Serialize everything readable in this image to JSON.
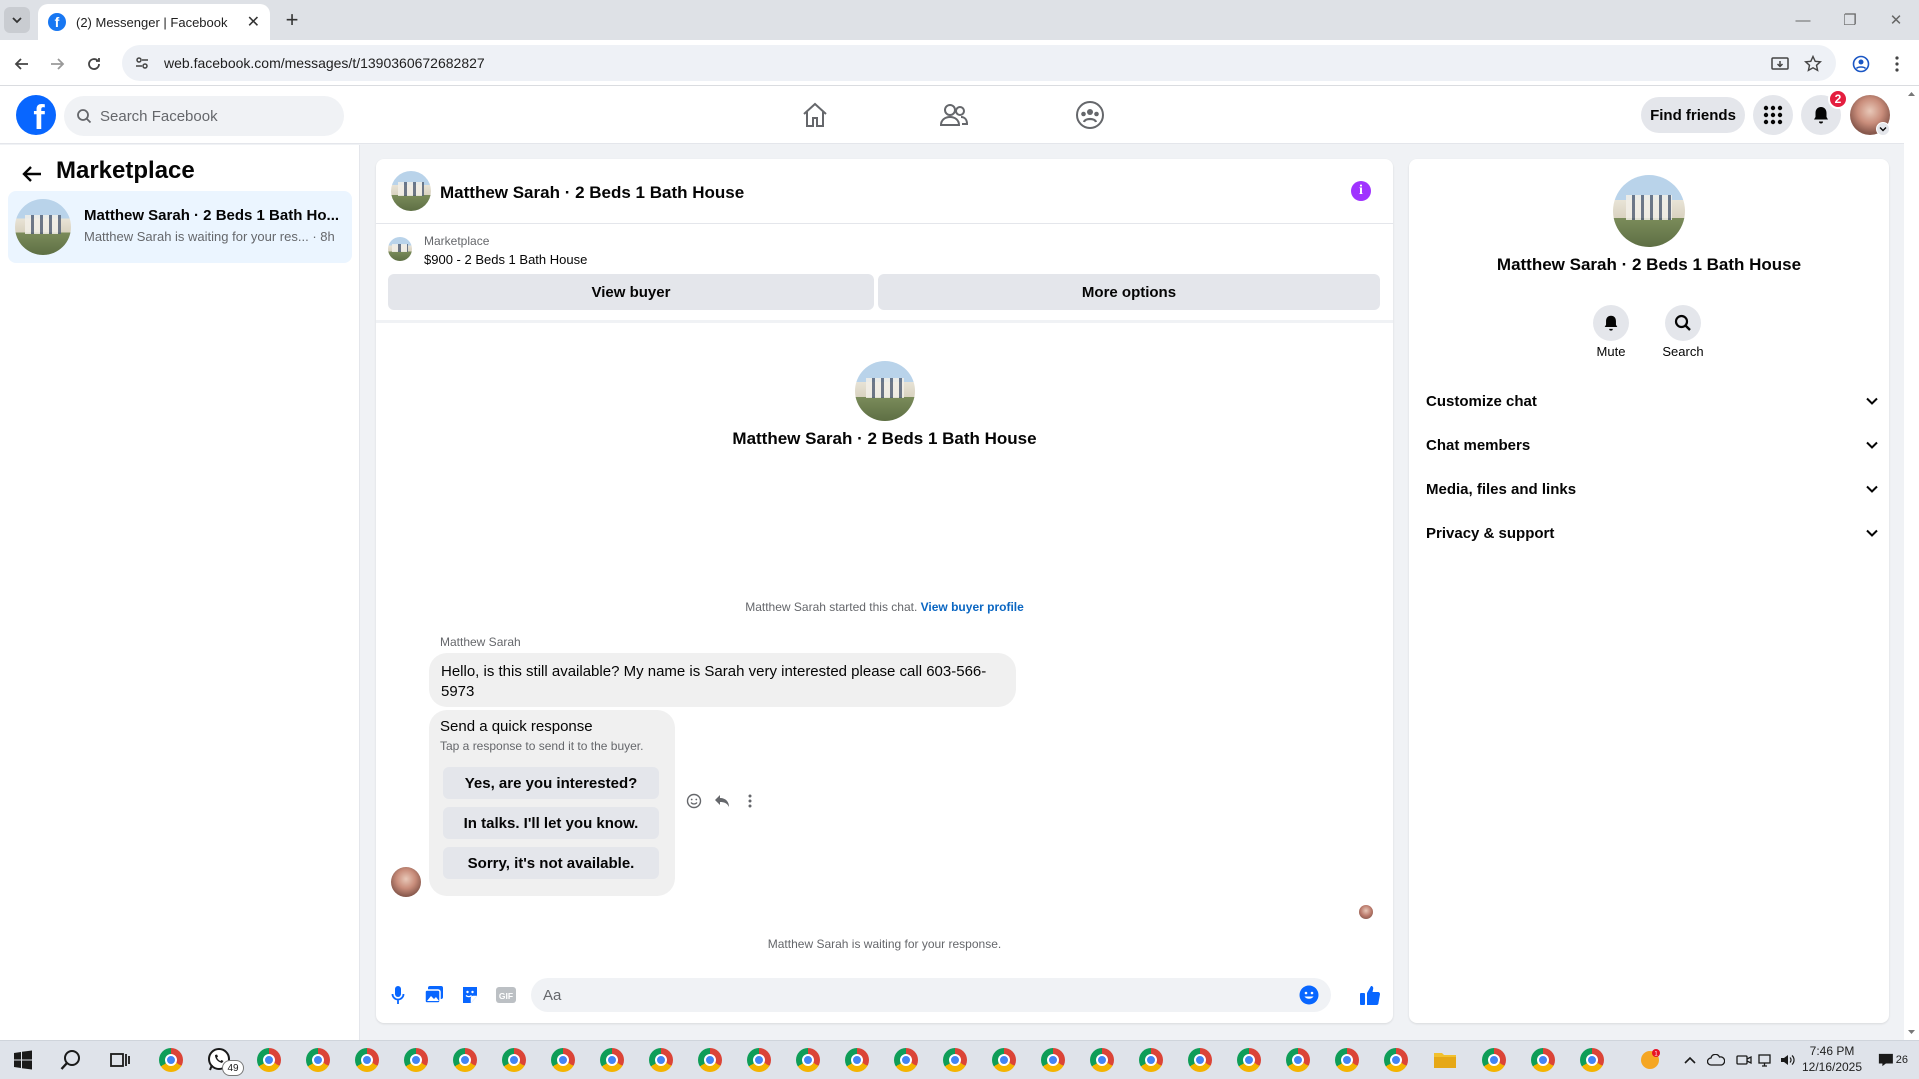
{
  "browser": {
    "tab_title": "(2) Messenger | Facebook",
    "url": "web.facebook.com/messages/t/1390360672682827"
  },
  "fb_header": {
    "search_placeholder": "Search Facebook",
    "find_friends": "Find friends",
    "notification_count": "2"
  },
  "left_panel": {
    "title": "Marketplace",
    "conversation": {
      "name": "Matthew Sarah · 2 Beds 1 Bath Ho...",
      "snippet": "Matthew Sarah is waiting for your res... · 8h"
    }
  },
  "chat": {
    "header_name": "Matthew Sarah · 2 Beds 1 Bath House",
    "marketplace_label": "Marketplace",
    "listing": "$900 - 2 Beds 1 Bath House",
    "view_buyer": "View buyer",
    "more_options": "More options",
    "center_name": "Matthew Sarah · 2 Beds 1 Bath House",
    "started_text": "Matthew Sarah started this chat.",
    "view_buyer_profile": "View buyer profile",
    "sender": "Matthew Sarah",
    "message": "Hello, is this still available? My name is Sarah very interested please call 603-566-5973",
    "quick_response_title": "Send a quick response",
    "quick_response_sub": "Tap a response to send it to the buyer.",
    "quick_responses": [
      "Yes, are you interested?",
      "In talks. I'll let you know.",
      "Sorry, it's not available."
    ],
    "waiting_text": "Matthew Sarah is waiting for your response.",
    "input_placeholder": "Aa"
  },
  "right_panel": {
    "name": "Matthew Sarah · 2 Beds 1 Bath House",
    "mute": "Mute",
    "search": "Search",
    "sections": [
      "Customize chat",
      "Chat members",
      "Media, files and links",
      "Privacy & support"
    ]
  },
  "taskbar": {
    "time": "7:46 PM",
    "date": "12/16/2025",
    "whatsapp_badge": "49",
    "notification_count": "26"
  },
  "colors": {
    "facebook_blue": "#0866ff",
    "messenger_accent": "#a033ff",
    "link_blue": "#0a66c2",
    "badge_red": "#e41e3f"
  }
}
